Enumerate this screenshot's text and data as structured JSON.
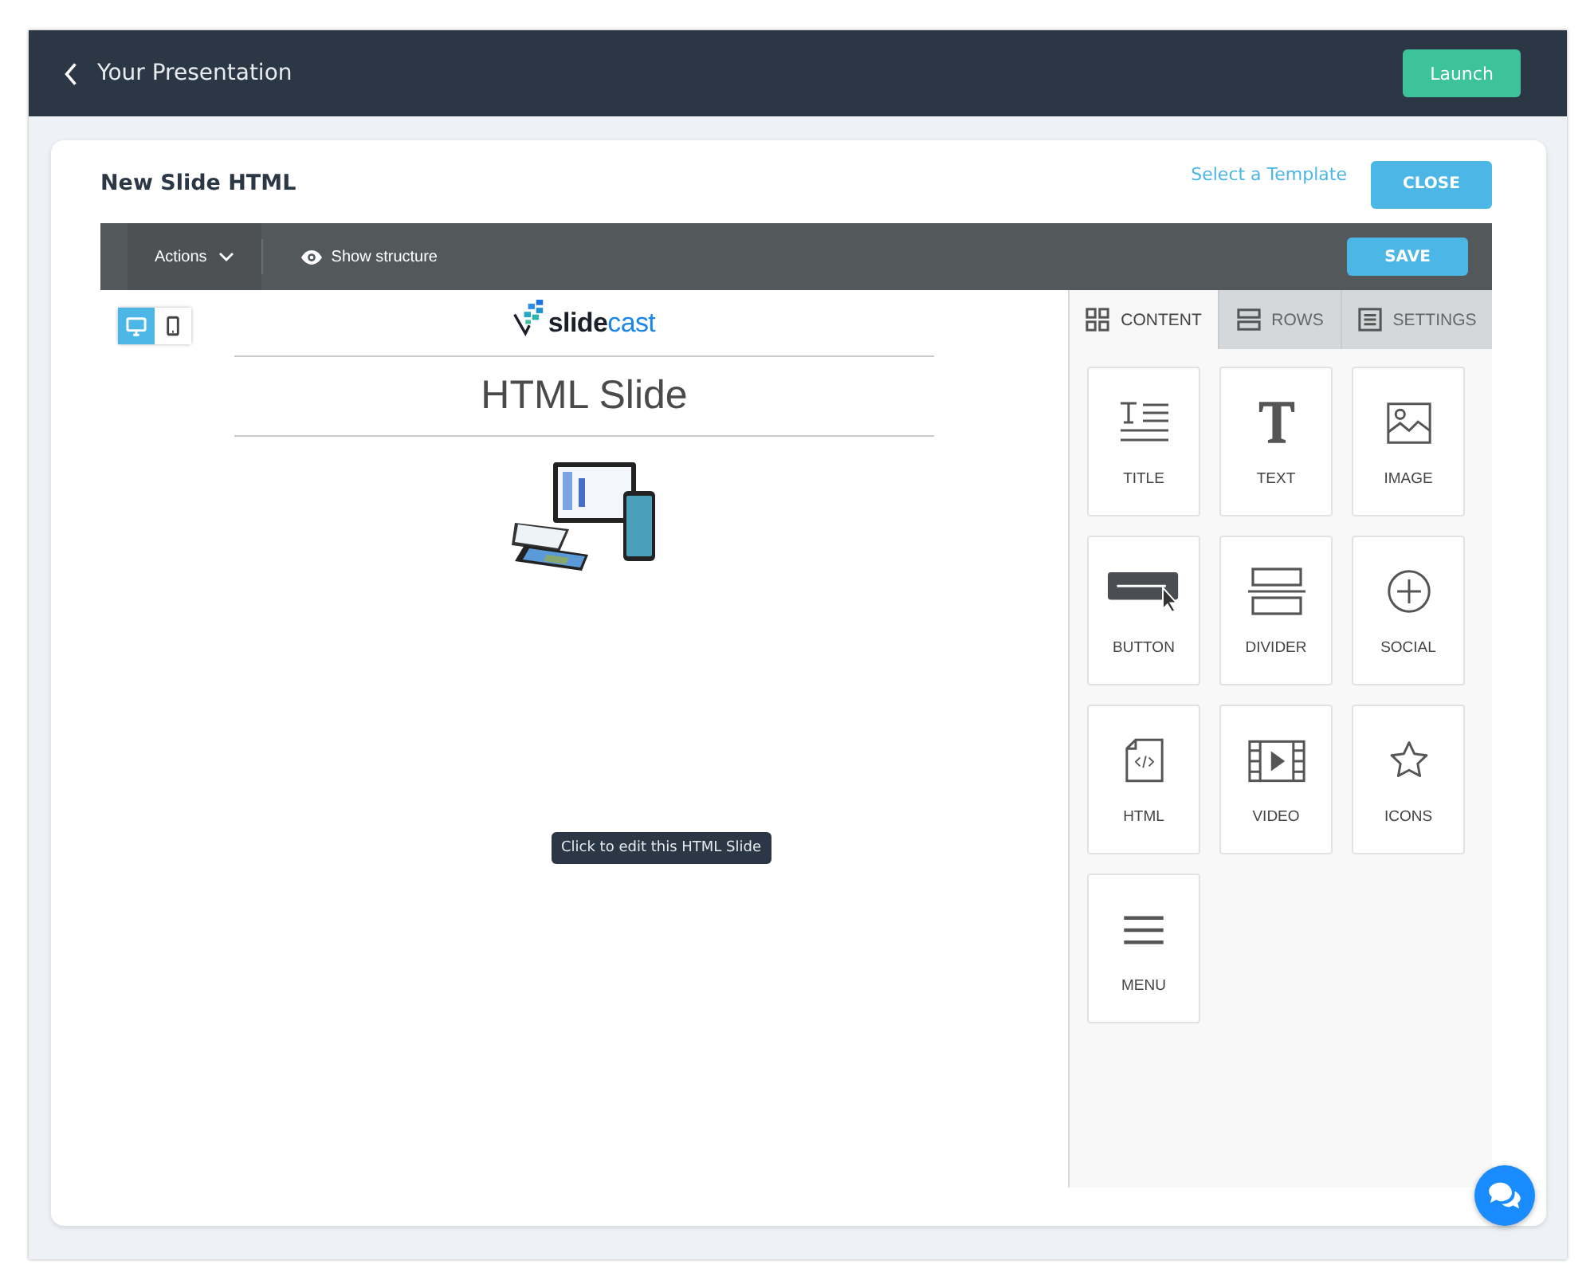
{
  "header": {
    "back_label": "Your Presentation",
    "launch_button": "Launch"
  },
  "editor": {
    "title": "New Slide HTML",
    "template_link": "Select a Template",
    "close_button": "CLOSE"
  },
  "toolbar": {
    "actions": "Actions",
    "show_structure": "Show structure",
    "save_button": "SAVE"
  },
  "devices": [
    {
      "kind": "desktop",
      "selected": true
    },
    {
      "kind": "mobile",
      "selected": false
    }
  ],
  "slide": {
    "logo": {
      "part_1": "slide",
      "part_2": "cast"
    },
    "heading": "HTML Slide",
    "tooltip": "Click to edit this HTML Slide"
  },
  "tabs": [
    {
      "kind": "content",
      "label": "CONTENT",
      "selected": true
    },
    {
      "kind": "rows",
      "label": "ROWS",
      "selected": false
    },
    {
      "kind": "settings",
      "label": "SETTINGS",
      "selected": false
    }
  ],
  "blocks": [
    {
      "kind": "title",
      "label": "TITLE"
    },
    {
      "kind": "text",
      "label": "TEXT"
    },
    {
      "kind": "image",
      "label": "IMAGE"
    },
    {
      "kind": "button",
      "label": "BUTTON"
    },
    {
      "kind": "divider",
      "label": "DIVIDER"
    },
    {
      "kind": "social",
      "label": "SOCIAL"
    },
    {
      "kind": "html",
      "label": "HTML"
    },
    {
      "kind": "video",
      "label": "VIDEO"
    },
    {
      "kind": "icons",
      "label": "ICONS"
    },
    {
      "kind": "menu",
      "label": "MENU"
    }
  ]
}
